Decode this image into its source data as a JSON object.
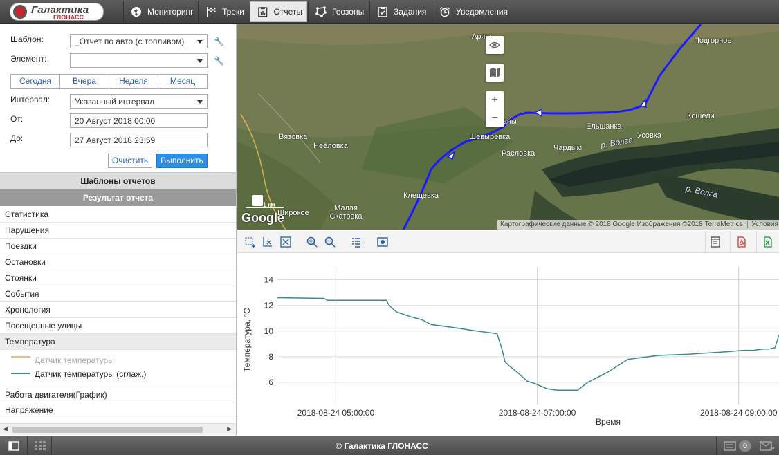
{
  "app": {
    "logo_title": "Галактика",
    "logo_sub": "ГЛОНАСС"
  },
  "nav": [
    {
      "label": "Мониторинг",
      "icon": "globe-icon"
    },
    {
      "label": "Треки",
      "icon": "flag-icon"
    },
    {
      "label": "Отчеты",
      "icon": "report-icon"
    },
    {
      "label": "Геозоны",
      "icon": "geofence-icon"
    },
    {
      "label": "Задания",
      "icon": "task-icon"
    },
    {
      "label": "Уведомления",
      "icon": "alarm-clock-icon"
    }
  ],
  "form": {
    "template_label": "Шаблон:",
    "template_value": "_Отчет по авто (с топливом)",
    "element_label": "Элемент:",
    "element_value": "",
    "periods": [
      "Сегодня",
      "Вчера",
      "Неделя",
      "Месяц"
    ],
    "interval_label": "Интервал:",
    "interval_value": "Указанный интервал",
    "from_label": "От:",
    "from_value": "20 Август 2018 00:00",
    "to_label": "До:",
    "to_value": "27 Август 2018 23:59",
    "clear_label": "Очистить",
    "run_label": "Выполнить"
  },
  "sections": {
    "templates": "Шаблоны отчетов",
    "result": "Результат отчета"
  },
  "report_items": [
    "Статистика",
    "Нарушения",
    "Поездки",
    "Остановки",
    "Стоянки",
    "События",
    "Хронология",
    "Посещенные улицы",
    "Температура"
  ],
  "report_items_after": [
    "Работа двигателя(График)",
    "Напряжение"
  ],
  "legend": [
    {
      "label": "Датчик температуры",
      "color": "#f5b887"
    },
    {
      "label": "Датчик температуры (сглаж.)",
      "color": "#3a8a8f"
    }
  ],
  "map": {
    "places": [
      "Аряш",
      "Подгорное",
      "Тарханы",
      "Кошели",
      "Ельшанка",
      "Усовка",
      "Вязовка",
      "Шевыревка",
      "Неёловка",
      "Расловка",
      "Чардым",
      "р. Волга",
      "р. Волга",
      "Малая Скатовка",
      "Широкое",
      "Клещевка"
    ],
    "attribution": "Картографические данные © 2018 Google Изображения ©2018 TerraMetrics",
    "terms": "Условия",
    "google": "Google",
    "scale": "1 км"
  },
  "colors": {
    "route": "#1a1aff",
    "active_tab": "#e9e9e9",
    "run_button": "#2b8fe6"
  },
  "footer": {
    "copyright": "© Галактика ГЛОНАСС",
    "messages_count": "0"
  },
  "chart_data": {
    "type": "line",
    "title": "",
    "xlabel": "Время",
    "ylabel": "Температура, °С",
    "ylim": [
      4.6,
      15
    ],
    "yticks": [
      6,
      8,
      10,
      12,
      14
    ],
    "xticks": [
      "2018-08-24 05:00:00",
      "2018-08-24 07:00:00",
      "2018-08-24 09:00:00"
    ],
    "xlim_hours": [
      4.42,
      9.4
    ],
    "series": [
      {
        "name": "Датчик температуры (сглаж.)",
        "x": [
          4.42,
          4.88,
          4.92,
          4.94,
          5.0,
          5.2,
          5.4,
          5.5,
          5.53,
          5.6,
          5.75,
          5.85,
          5.95,
          6.15,
          6.4,
          6.6,
          6.65,
          6.68,
          6.72,
          6.8,
          6.9,
          6.98,
          7.1,
          7.2,
          7.4,
          7.5,
          7.7,
          7.9,
          8.2,
          8.5,
          8.9,
          9.05,
          9.1,
          9.15,
          9.24,
          9.3,
          9.36,
          9.4
        ],
        "values": [
          12.6,
          12.55,
          12.4,
          12.4,
          12.4,
          12.4,
          12.4,
          12.4,
          12.0,
          11.5,
          11.1,
          10.9,
          10.5,
          10.3,
          10.0,
          9.8,
          8.6,
          7.6,
          7.3,
          6.8,
          6.1,
          5.9,
          5.5,
          5.4,
          5.4,
          6.0,
          6.8,
          7.8,
          8.1,
          8.2,
          8.4,
          8.5,
          8.5,
          8.5,
          8.6,
          8.6,
          8.7,
          9.7
        ]
      }
    ]
  }
}
